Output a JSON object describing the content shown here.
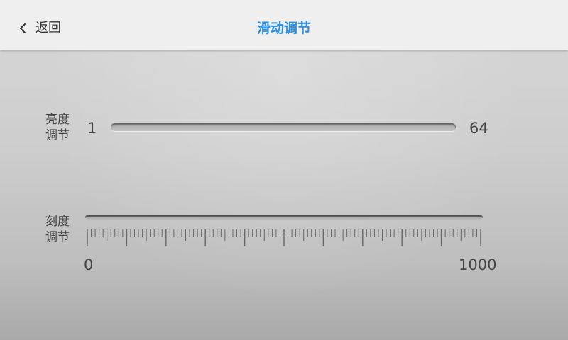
{
  "header": {
    "back_label": "返回",
    "title": "滑动调节",
    "title_color": "#2b8fe8"
  },
  "brightness": {
    "label_line1": "亮度",
    "label_line2": "调节",
    "min_label": "1",
    "max_label": "64"
  },
  "scale": {
    "label_line1": "刻度",
    "label_line2": "调节",
    "min_label": "0",
    "max_label": "1000"
  },
  "icons": {
    "back": "chevron-left-icon"
  }
}
